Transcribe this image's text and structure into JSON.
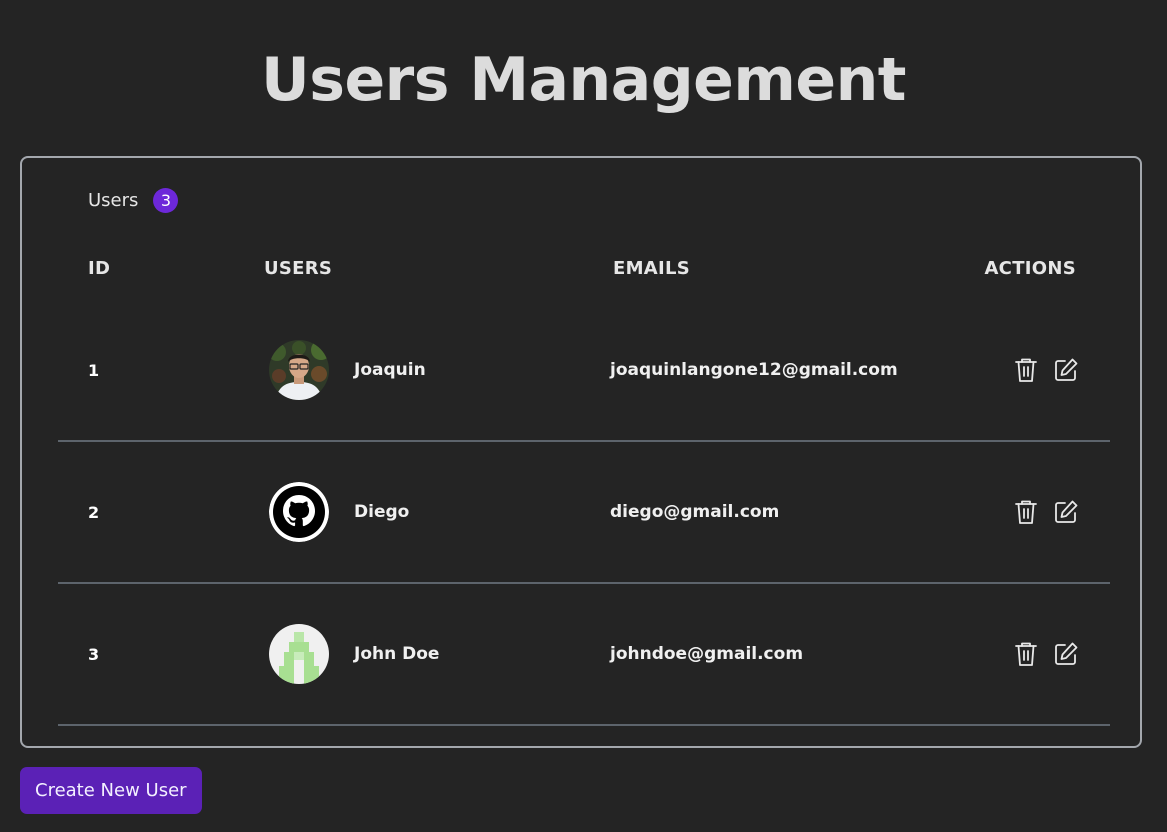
{
  "page": {
    "title": "Users Management"
  },
  "users_panel": {
    "label": "Users",
    "count": "3"
  },
  "table": {
    "columns": [
      "ID",
      "USERS",
      "EMAILS",
      "ACTIONS"
    ],
    "rows": [
      {
        "id": "1",
        "name": "Joaquin",
        "email": "joaquinlangone12@gmail.com",
        "avatar": "photo-avatar"
      },
      {
        "id": "2",
        "name": "Diego",
        "email": "diego@gmail.com",
        "avatar": "github-octocat-avatar"
      },
      {
        "id": "3",
        "name": "John Doe",
        "email": "johndoe@gmail.com",
        "avatar": "identicon-avatar"
      }
    ],
    "row_actions": [
      "trash-icon",
      "edit-icon"
    ]
  },
  "footer": {
    "create_button_label": "Create New User"
  },
  "colors": {
    "background": "#242424",
    "accent": "#5b21b6",
    "badge": "#6d28d9",
    "card_border": "#a3a7ad",
    "row_divider": "#5d646c"
  }
}
